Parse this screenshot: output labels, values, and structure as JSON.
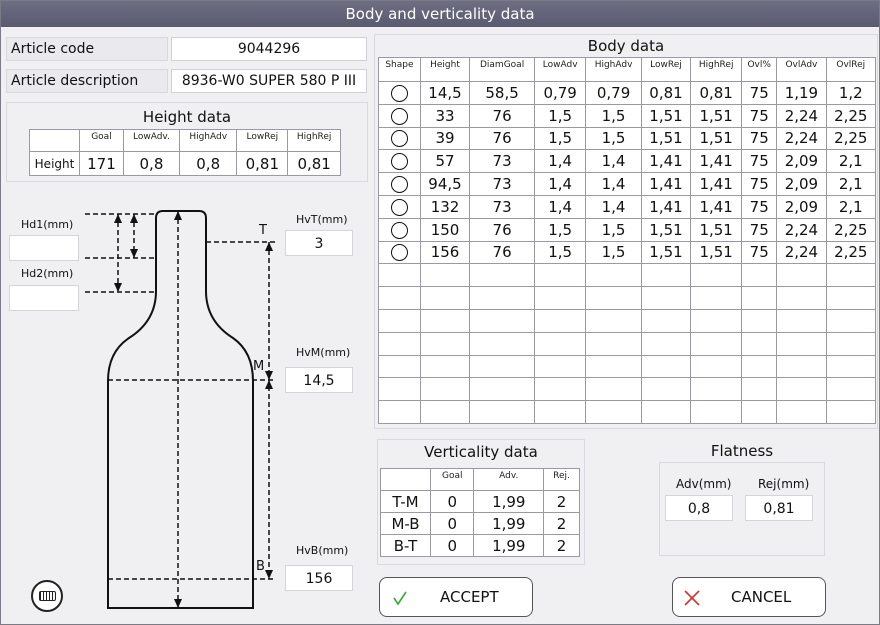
{
  "window": {
    "title": "Body and verticality data"
  },
  "article": {
    "code_label": "Article code",
    "code_value": "9044296",
    "desc_label": "Article description",
    "desc_value": "8936-W0 SUPER 580 P III"
  },
  "height_data": {
    "title": "Height data",
    "columns": [
      "Goal",
      "LowAdv.",
      "HighAdv",
      "LowRej",
      "HighRej"
    ],
    "row_label": "Height",
    "values": [
      "171",
      "0,8",
      "0,8",
      "0,81",
      "0,81"
    ]
  },
  "bottle": {
    "hd1_label": "Hd1(mm)",
    "hd1_value": "",
    "hd2_label": "Hd2(mm)",
    "hd2_value": "",
    "hvt_label": "HvT(mm)",
    "hvt_value": "3",
    "hvm_label": "HvM(mm)",
    "hvm_value": "14,5",
    "hvb_label": "HvB(mm)",
    "hvb_value": "156",
    "letter_t": "T",
    "letter_m": "M",
    "letter_b": "B"
  },
  "body_data": {
    "title": "Body data",
    "columns": [
      "Shape",
      "Height",
      "DiamGoal",
      "LowAdv",
      "HighAdv",
      "LowRej",
      "HighRej",
      "Ovl%",
      "OvlAdv",
      "OvlRej"
    ],
    "rows": [
      [
        "14,5",
        "58,5",
        "0,79",
        "0,79",
        "0,81",
        "0,81",
        "75",
        "1,19",
        "1,2"
      ],
      [
        "33",
        "76",
        "1,5",
        "1,5",
        "1,51",
        "1,51",
        "75",
        "2,24",
        "2,25"
      ],
      [
        "39",
        "76",
        "1,5",
        "1,5",
        "1,51",
        "1,51",
        "75",
        "2,24",
        "2,25"
      ],
      [
        "57",
        "73",
        "1,4",
        "1,4",
        "1,41",
        "1,41",
        "75",
        "2,09",
        "2,1"
      ],
      [
        "94,5",
        "73",
        "1,4",
        "1,4",
        "1,41",
        "1,41",
        "75",
        "2,09",
        "2,1"
      ],
      [
        "132",
        "73",
        "1,4",
        "1,4",
        "1,41",
        "1,41",
        "75",
        "2,09",
        "2,1"
      ],
      [
        "150",
        "76",
        "1,5",
        "1,5",
        "1,51",
        "1,51",
        "75",
        "2,24",
        "2,25"
      ],
      [
        "156",
        "76",
        "1,5",
        "1,5",
        "1,51",
        "1,51",
        "75",
        "2,24",
        "2,25"
      ]
    ]
  },
  "verticality": {
    "title": "Verticality data",
    "columns": [
      "Goal",
      "Adv.",
      "Rej."
    ],
    "rows": [
      {
        "label": "T-M",
        "values": [
          "0",
          "1,99",
          "2"
        ]
      },
      {
        "label": "M-B",
        "values": [
          "0",
          "1,99",
          "2"
        ]
      },
      {
        "label": "B-T",
        "values": [
          "0",
          "1,99",
          "2"
        ]
      }
    ]
  },
  "flatness": {
    "title": "Flatness",
    "adv_label": "Adv(mm)",
    "adv_value": "0,8",
    "rej_label": "Rej(mm)",
    "rej_value": "0,81"
  },
  "buttons": {
    "accept": "ACCEPT",
    "cancel": "CANCEL"
  },
  "icons": {
    "keyboard": "keyboard-icon",
    "accept": "checkmark-icon",
    "cancel": "x-icon"
  },
  "colors": {
    "accept_check": "#3aa63a",
    "cancel_x": "#d93030",
    "titlebar": "#62637a"
  }
}
